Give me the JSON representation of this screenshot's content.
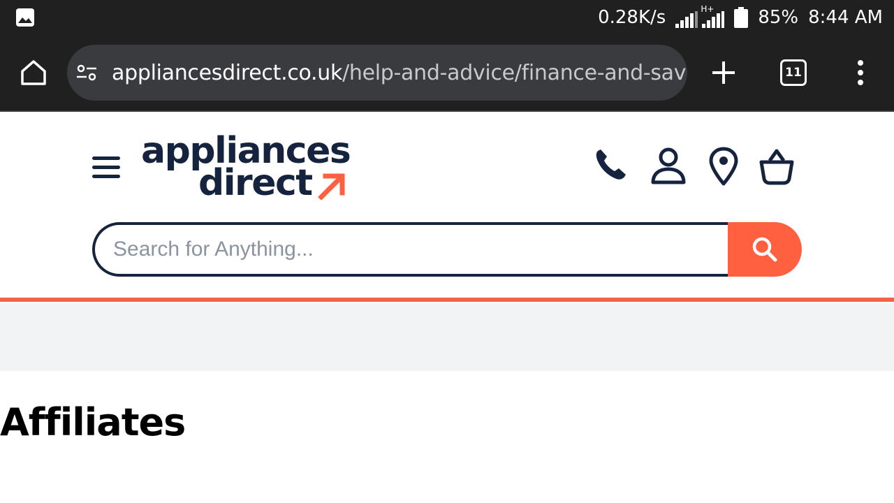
{
  "status_bar": {
    "net_speed": "0.28K/s",
    "network_type": "H+",
    "battery": "85%",
    "time": "8:44 AM",
    "icons": [
      "gallery-icon",
      "signal-icon",
      "battery-icon"
    ]
  },
  "browser": {
    "url_host": "appliancesdirect.co.uk",
    "url_path": "/help-and-advice/finance-and-savi",
    "tab_count": "11",
    "icons": [
      "home-icon",
      "site-settings-icon",
      "plus-icon",
      "tabs-icon",
      "more-vert-icon"
    ]
  },
  "header": {
    "logo_line1": "appliances",
    "logo_line2": "direct",
    "icons": [
      "menu-icon",
      "phone-icon",
      "account-icon",
      "location-icon",
      "basket-icon"
    ]
  },
  "search": {
    "placeholder": "Search for Anything...",
    "value": ""
  },
  "page": {
    "title": "Affiliates"
  },
  "colors": {
    "brand_navy": "#16233e",
    "brand_orange": "#ff6140",
    "chrome_dark": "#202020",
    "band_grey": "#f2f3f5"
  }
}
